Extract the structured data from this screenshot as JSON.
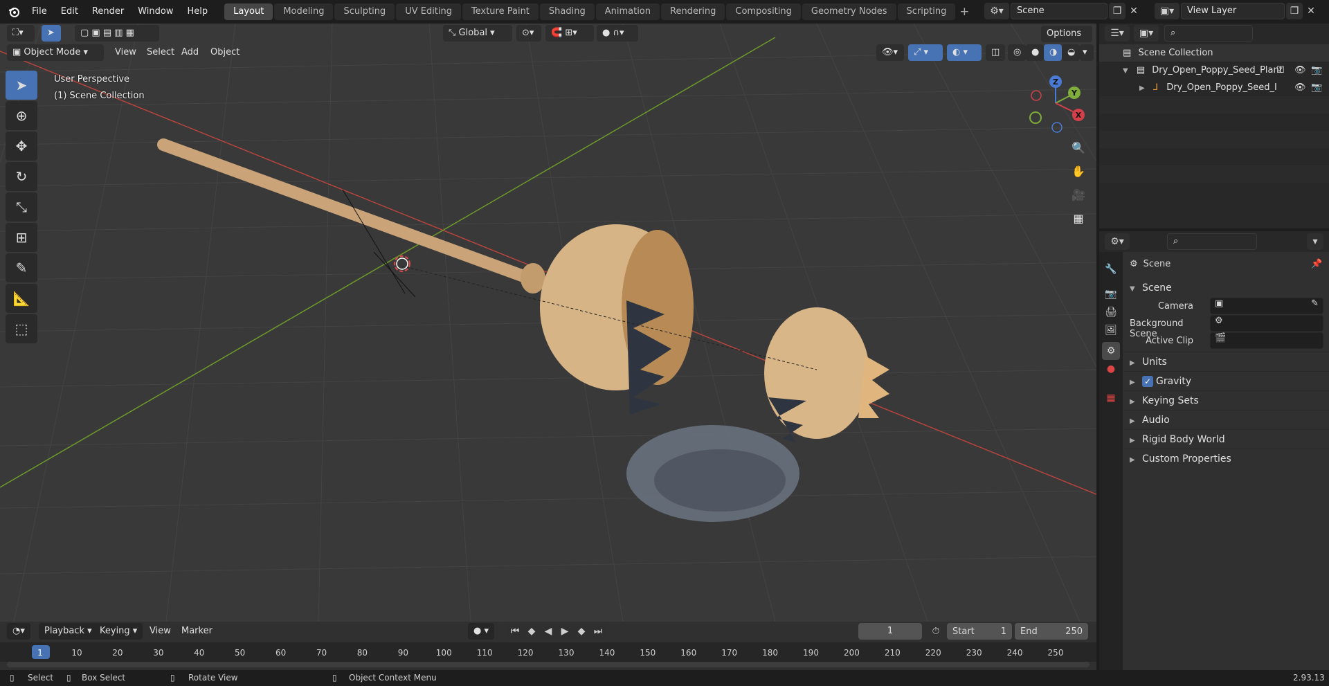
{
  "topbar": {
    "menus": [
      "File",
      "Edit",
      "Render",
      "Window",
      "Help"
    ],
    "workspaces": [
      "Layout",
      "Modeling",
      "Sculpting",
      "UV Editing",
      "Texture Paint",
      "Shading",
      "Animation",
      "Rendering",
      "Compositing",
      "Geometry Nodes",
      "Scripting"
    ],
    "active_workspace": "Layout",
    "scene_name": "Scene",
    "view_layer": "View Layer"
  },
  "viewport": {
    "mode": "Object Mode",
    "menus": [
      "View",
      "Select",
      "Add",
      "Object"
    ],
    "transform_orientation": "Global",
    "options_label": "Options",
    "perspective_label": "User Perspective",
    "collection_label": "(1) Scene Collection",
    "gizmo": {
      "x": "X",
      "y": "Y",
      "z": "Z"
    },
    "colors": {
      "x_axis": "#b8443d",
      "y_axis": "#6e9a29",
      "grid": "#444444",
      "background": "#393939",
      "active_tool": "#4772b3"
    }
  },
  "timeline": {
    "menus": [
      "Playback",
      "Keying",
      "View",
      "Marker"
    ],
    "current_frame": "1",
    "start_label": "Start",
    "start_value": "1",
    "end_label": "End",
    "end_value": "250",
    "ruler": [
      "1",
      "10",
      "20",
      "30",
      "40",
      "50",
      "60",
      "70",
      "80",
      "90",
      "100",
      "110",
      "120",
      "130",
      "140",
      "150",
      "160",
      "170",
      "180",
      "190",
      "200",
      "210",
      "220",
      "230",
      "240",
      "250"
    ]
  },
  "statusbar": {
    "select": "Select",
    "box_select": "Box Select",
    "rotate_view": "Rotate View",
    "context_menu": "Object Context Menu",
    "version": "2.93.13"
  },
  "outliner": {
    "root": "Scene Collection",
    "items": [
      {
        "label": "Dry_Open_Poppy_Seed_Plant"
      },
      {
        "label": "Dry_Open_Poppy_Seed_I"
      }
    ]
  },
  "properties": {
    "context_title": "Scene",
    "section_title": "Scene",
    "camera_label": "Camera",
    "background_scene_label": "Background Scene",
    "active_clip_label": "Active Clip",
    "panels": [
      "Units",
      "Gravity",
      "Keying Sets",
      "Audio",
      "Rigid Body World",
      "Custom Properties"
    ],
    "gravity_checked": true
  }
}
